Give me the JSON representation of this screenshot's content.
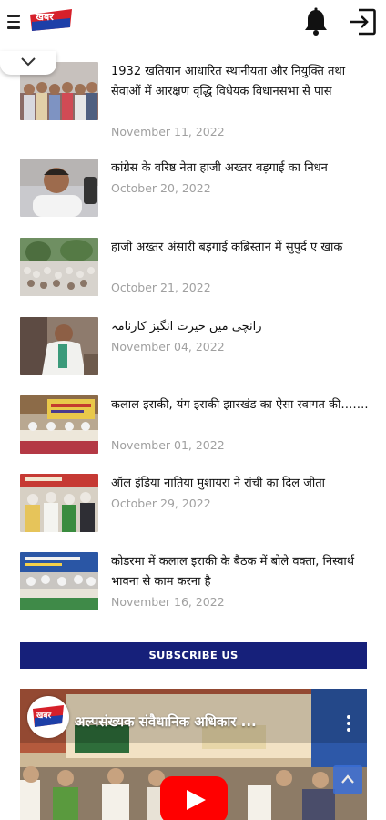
{
  "header": {
    "logo_text": "खबर",
    "icons": [
      "menu-icon",
      "bell-icon",
      "exit-icon"
    ]
  },
  "collapse": {
    "icon": "chevron-down-icon"
  },
  "news": [
    {
      "title": "1932 खतियान आधारित स्थानीयता और नियुक्ति तथा सेवाओं में आरक्षण वृद्धि विधेयक विधानसभा से पास",
      "date": "November 11, 2022"
    },
    {
      "title": "कांग्रेस के वरिष्ठ नेता हाजी अख्तर बड़गाई का निधन",
      "date": "October 20, 2022"
    },
    {
      "title": "हाजी अख्तर अंसारी बड़गाई कब्रिस्तान में सुपुर्द ए खाक",
      "date": "October 21, 2022"
    },
    {
      "title": "رانچی میں حیرت انگیز کارنامہ",
      "date": "November 04, 2022"
    },
    {
      "title": "कलाल इराकी, यंग इराकी झारखंड का ऐसा स्वागत की…….",
      "date": "November 01, 2022"
    },
    {
      "title": "ऑल इंडिया नातिया मुशायरा ने रांची का दिल जीता",
      "date": "October 29, 2022"
    },
    {
      "title": "कोडरमा में कलाल इराकी के बैठक में बोले वक्ता, निस्वार्थ भावना से काम करना है",
      "date": "November 16, 2022"
    }
  ],
  "subscribe": {
    "label": "SUBSCRIBE US"
  },
  "video": {
    "title": "अल्पसंख्यक संवैधानिक अधिकार ...",
    "channel_logo_text": "खबर"
  },
  "colors": {
    "accent": "#16207a",
    "date": "#a0a0a0",
    "logo_red": "#d6202a",
    "logo_blue": "#1d3fa8"
  }
}
